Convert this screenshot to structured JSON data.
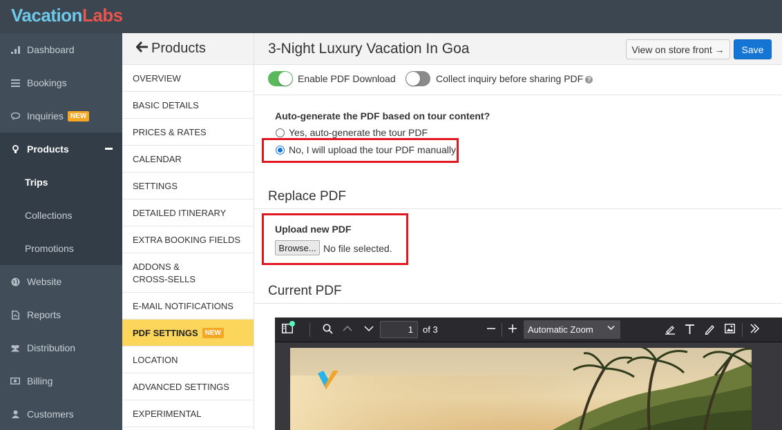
{
  "brand": {
    "part1": "Vacation",
    "part2": "Labs"
  },
  "main_nav": [
    {
      "label": "Dashboard",
      "icon": "dashboard-icon"
    },
    {
      "label": "Bookings",
      "icon": "list-icon"
    },
    {
      "label": "Inquiries",
      "icon": "chat-icon",
      "badge": "NEW"
    },
    {
      "label": "Products",
      "icon": "lightbulb-icon",
      "active": true
    },
    {
      "label": "Website",
      "icon": "globe-icon"
    },
    {
      "label": "Reports",
      "icon": "report-icon"
    },
    {
      "label": "Distribution",
      "icon": "users-icon"
    },
    {
      "label": "Billing",
      "icon": "money-icon"
    },
    {
      "label": "Customers",
      "icon": "user-icon"
    }
  ],
  "products_sub": [
    "Trips",
    "Collections",
    "Promotions"
  ],
  "subnav": {
    "title": "Products",
    "items": [
      "OVERVIEW",
      "BASIC DETAILS",
      "PRICES & RATES",
      "CALENDAR",
      "SETTINGS",
      "DETAILED ITINERARY",
      "EXTRA BOOKING FIELDS",
      "ADDONS & CROSS-SELLS",
      "E-MAIL NOTIFICATIONS",
      "PDF SETTINGS",
      "LOCATION",
      "ADVANCED SETTINGS",
      "EXPERIMENTAL"
    ],
    "selected_badge": "NEW"
  },
  "header": {
    "title": "3-Night Luxury Vacation In Goa",
    "view_store": "View on store front →",
    "save": "Save"
  },
  "toggles": {
    "enable_pdf": "Enable PDF Download",
    "collect_inquiry": "Collect inquiry before sharing PDF"
  },
  "autogen": {
    "question": "Auto-generate the PDF based on tour content?",
    "option_yes": "Yes, auto-generate the tour PDF",
    "option_no": "No, I will upload the tour PDF manually"
  },
  "replace": {
    "title": "Replace PDF",
    "upload_label": "Upload new PDF",
    "browse": "Browse...",
    "no_file": "No file selected."
  },
  "current": {
    "title": "Current PDF"
  },
  "viewer": {
    "page": "1",
    "of_pages": "of 3",
    "zoom": "Automatic Zoom"
  },
  "colors": {
    "topbar": "#3b4651",
    "sidebar": "#414d59",
    "accent_blue": "#1475d4",
    "selected_yellow": "#fcd65a",
    "highlight_red": "#e0171f",
    "toggle_green": "#5cb85c"
  }
}
